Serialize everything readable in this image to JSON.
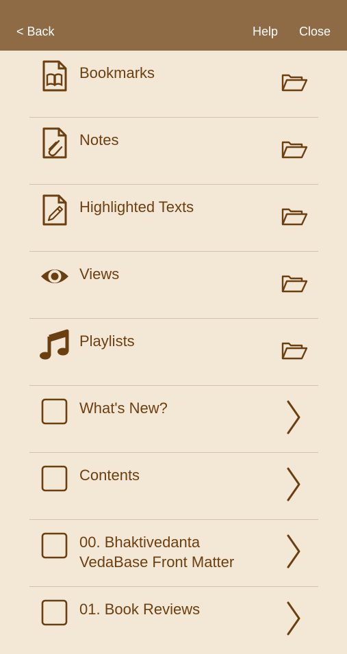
{
  "navbar": {
    "back_label": "< Back",
    "help_label": "Help",
    "close_label": "Close",
    "background": "#8f6b45"
  },
  "colors": {
    "background": "#f3e8d6",
    "accent": "#6b3f10",
    "separator": "#d2c2aa"
  },
  "rows": [
    {
      "label": "Bookmarks",
      "icon": "book-document-icon",
      "trailing": "folder-icon"
    },
    {
      "label": "Notes",
      "icon": "paperclip-document-icon",
      "trailing": "folder-icon"
    },
    {
      "label": "Highlighted Texts",
      "icon": "pencil-document-icon",
      "trailing": "folder-icon"
    },
    {
      "label": "Views",
      "icon": "eye-icon",
      "trailing": "folder-icon"
    },
    {
      "label": "Playlists",
      "icon": "music-note-icon",
      "trailing": "folder-icon"
    },
    {
      "label": "What's New?",
      "icon": "checkbox-icon",
      "trailing": "chevron-right-icon"
    },
    {
      "label": "Contents",
      "icon": "checkbox-icon",
      "trailing": "chevron-right-icon"
    },
    {
      "label": "00. Bhaktivedanta\nVedaBase Front Matter",
      "icon": "checkbox-icon",
      "trailing": "chevron-right-icon"
    },
    {
      "label": "01. Book Reviews",
      "icon": "checkbox-icon",
      "trailing": "chevron-right-icon"
    }
  ]
}
